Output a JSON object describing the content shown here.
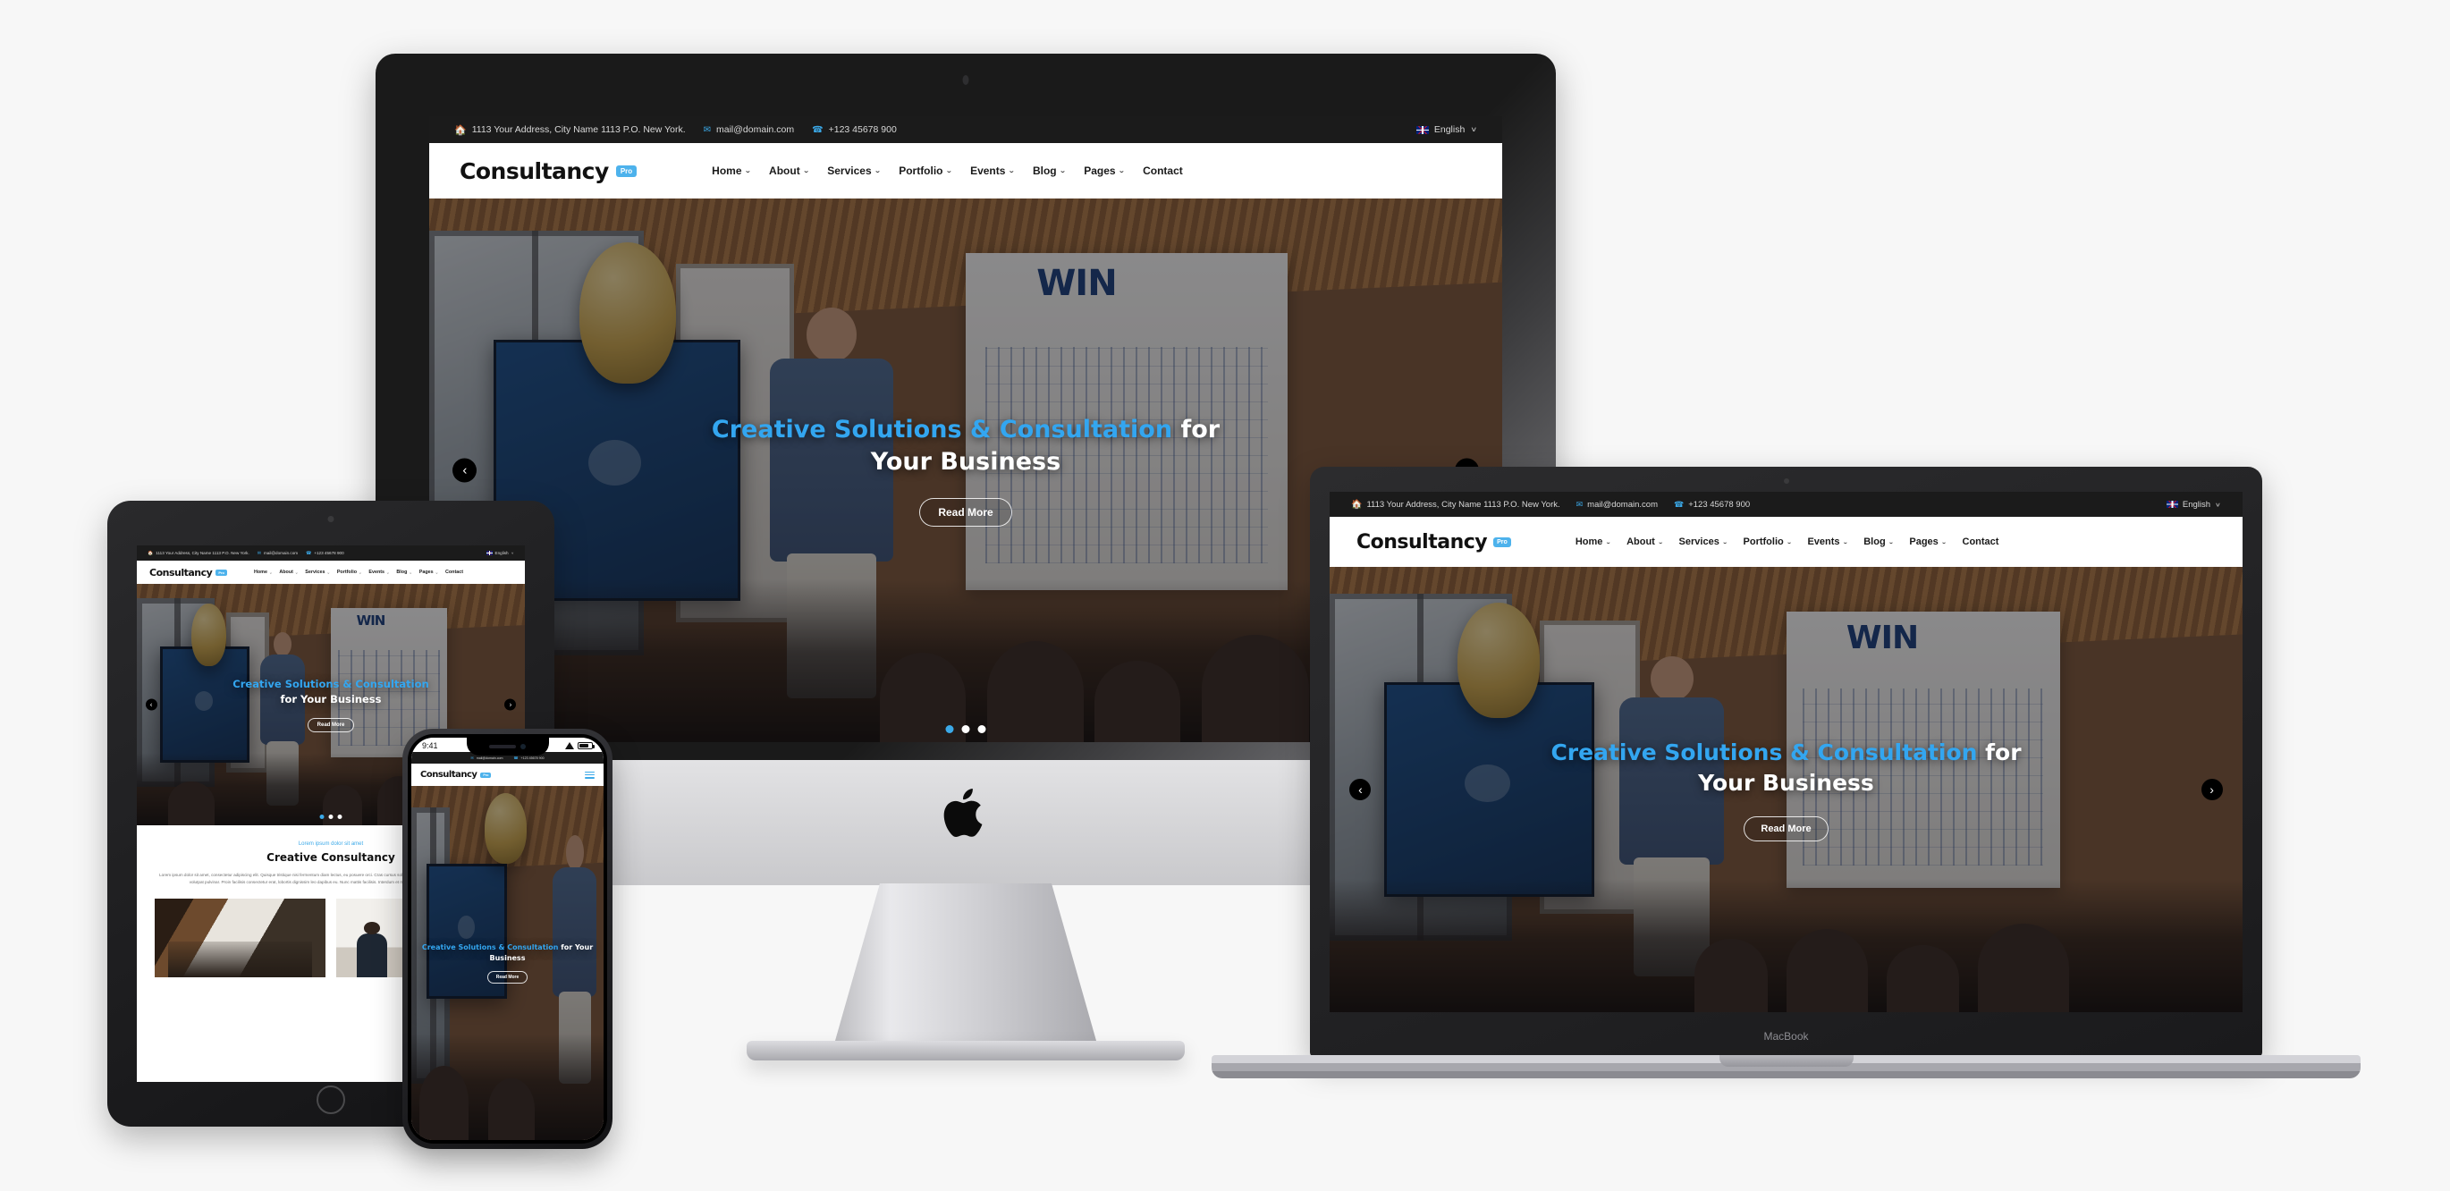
{
  "background_color": "#f7f7f7",
  "accent_color": "#3ba9e8",
  "site": {
    "topbar": {
      "address": "1113 Your Address, City Name 1113 P.O. New York.",
      "email": "mail@domain.com",
      "phone": "+123 45678 900",
      "language": "English",
      "language_caret": "∨",
      "home_icon": "home-icon",
      "mail_icon": "envelope-icon",
      "phone_icon": "phone-icon",
      "flag_icon": "uk-flag-icon"
    },
    "brand": {
      "name": "Consultancy",
      "badge": "Pro"
    },
    "nav": [
      {
        "label": "Home",
        "caret": "⌄"
      },
      {
        "label": "About",
        "caret": "⌄"
      },
      {
        "label": "Services",
        "caret": "⌄"
      },
      {
        "label": "Portfolio",
        "caret": "⌄"
      },
      {
        "label": "Events",
        "caret": "⌄"
      },
      {
        "label": "Blog",
        "caret": "⌄"
      },
      {
        "label": "Pages",
        "caret": "⌄"
      },
      {
        "label": "Contact",
        "caret": ""
      }
    ],
    "hero": {
      "title_accent": "Creative Solutions & Consultation",
      "title_rest_desktop": " for",
      "title_line2_desktop": "Your Business",
      "title_rest_tablet": "",
      "title_line2_tablet": "for Your Business",
      "title_rest_mobile": " for Your",
      "title_line2_mobile": "Business",
      "cta": "Read More",
      "prev_icon": "chevron-left-icon",
      "next_icon": "chevron-right-icon",
      "board_text": "WIN",
      "slides": 3,
      "active_slide": 1
    },
    "about_section": {
      "subtitle": "Lorem ipsum dolor sit amet",
      "title": "Creative Consultancy",
      "body": "Lorem ipsum dolor sit amet, consectetur adipiscing elit. Quisque tristique nisi fermentum diam lectus, eu posuere orci. Cras cursus sollicitudin vehicula. Donec eu facilisis nunc. Suspendisse volutpat pulvinar. Proin facilisis consectetur erat, lobortis dignissim leo dapibus eu. Nunc mattis facilisis. Interdum et malesuada fames ac ante ipsum primis."
    },
    "mobile": {
      "menu_icon": "hamburger-menu-icon"
    }
  },
  "devices": {
    "imac": {
      "name": "iMac",
      "logo": "apple-logo-icon"
    },
    "macbook": {
      "name": "MacBook",
      "label": "MacBook"
    },
    "ipad": {
      "name": "iPad",
      "home_button": "home-button"
    },
    "iphone": {
      "name": "iPhone",
      "status_time": "9:41",
      "wifi_icon": "wifi-icon",
      "battery_icon": "battery-icon"
    }
  }
}
